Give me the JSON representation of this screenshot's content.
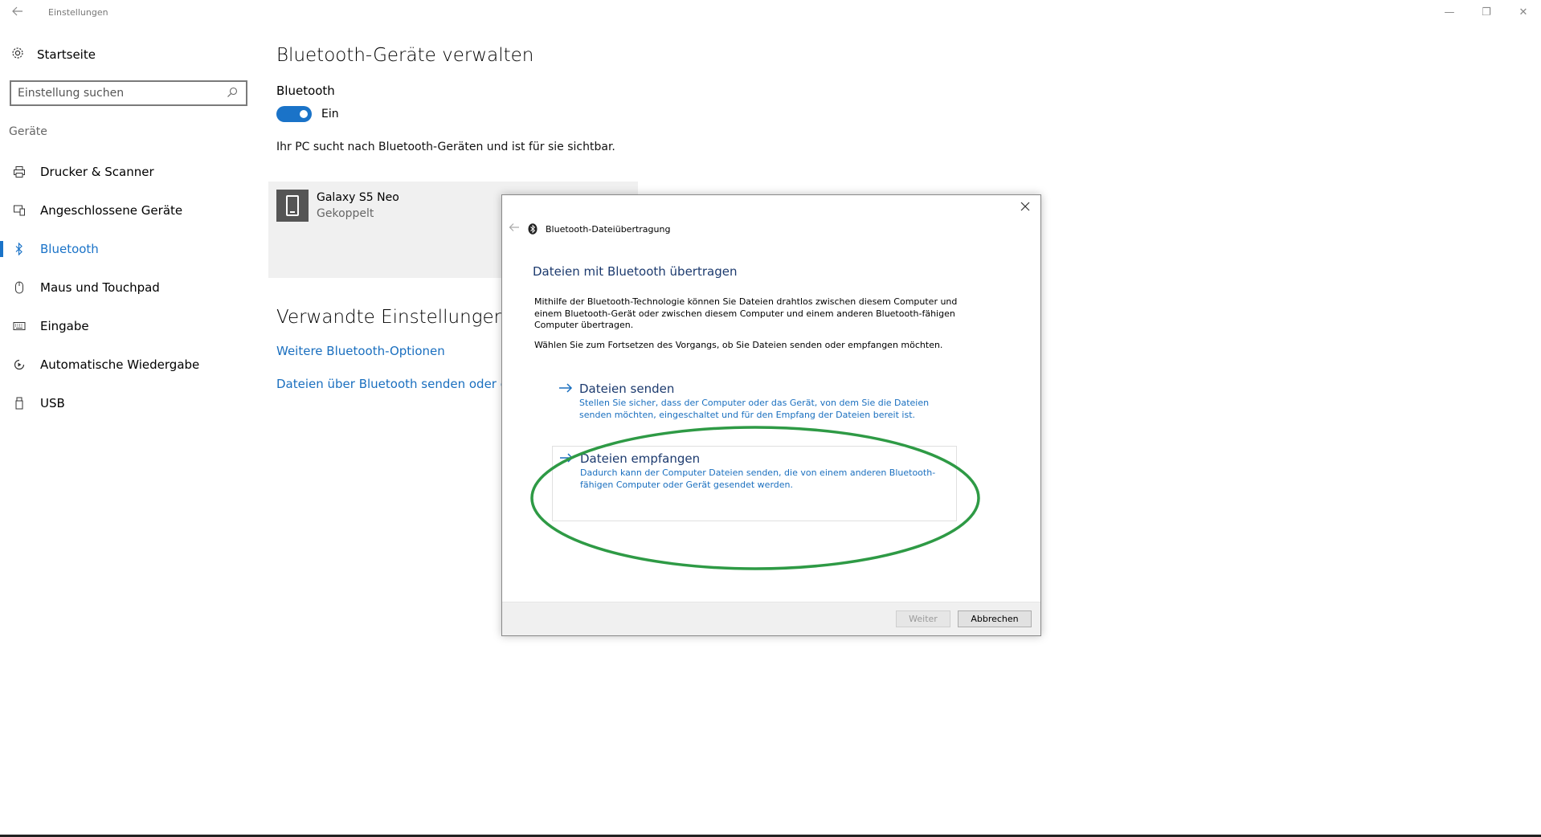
{
  "window": {
    "title": "Einstellungen",
    "back_icon": "back-arrow-icon",
    "minimize_glyph": "—",
    "restore_glyph": "❐",
    "close_glyph": "✕"
  },
  "sidebar": {
    "home_label": "Startseite",
    "search_placeholder": "Einstellung suchen",
    "section_label": "Geräte",
    "items": [
      {
        "label": "Drucker & Scanner",
        "icon": "printer-icon"
      },
      {
        "label": "Angeschlossene Geräte",
        "icon": "connected-devices-icon"
      },
      {
        "label": "Bluetooth",
        "icon": "bluetooth-icon",
        "active": true
      },
      {
        "label": "Maus und Touchpad",
        "icon": "mouse-icon"
      },
      {
        "label": "Eingabe",
        "icon": "keyboard-icon"
      },
      {
        "label": "Automatische Wiedergabe",
        "icon": "autoplay-icon"
      },
      {
        "label": "USB",
        "icon": "usb-icon"
      }
    ]
  },
  "main": {
    "title": "Bluetooth-Geräte verwalten",
    "bluetooth_label": "Bluetooth",
    "toggle_state": "Ein",
    "description": "Ihr PC sucht nach Bluetooth-Geräten und ist für sie sichtbar.",
    "device": {
      "name": "Galaxy S5 Neo",
      "status": "Gekoppelt"
    },
    "related_title": "Verwandte Einstellungen",
    "links": [
      "Weitere Bluetooth-Optionen",
      "Dateien über Bluetooth senden oder empf"
    ]
  },
  "dialog": {
    "header_title": "Bluetooth-Dateiübertragung",
    "heading": "Dateien mit Bluetooth übertragen",
    "paragraph1": "Mithilfe der Bluetooth-Technologie können Sie Dateien drahtlos zwischen diesem Computer und einem Bluetooth-Gerät oder zwischen diesem Computer und einem anderen Bluetooth-fähigen Computer übertragen.",
    "paragraph2": "Wählen Sie zum Fortsetzen des Vorgangs, ob Sie Dateien senden oder empfangen möchten.",
    "options": [
      {
        "title": "Dateien senden",
        "desc": "Stellen Sie sicher, dass der Computer oder das Gerät, von dem Sie die Dateien senden möchten, eingeschaltet und für den Empfang der Dateien bereit ist."
      },
      {
        "title": "Dateien empfangen",
        "desc": "Dadurch kann der Computer Dateien senden, die von einem anderen Bluetooth-fähigen Computer oder Gerät gesendet werden."
      }
    ],
    "btn_next": "Weiter",
    "btn_cancel": "Abbrechen",
    "highlight_color": "#2e9a45"
  }
}
